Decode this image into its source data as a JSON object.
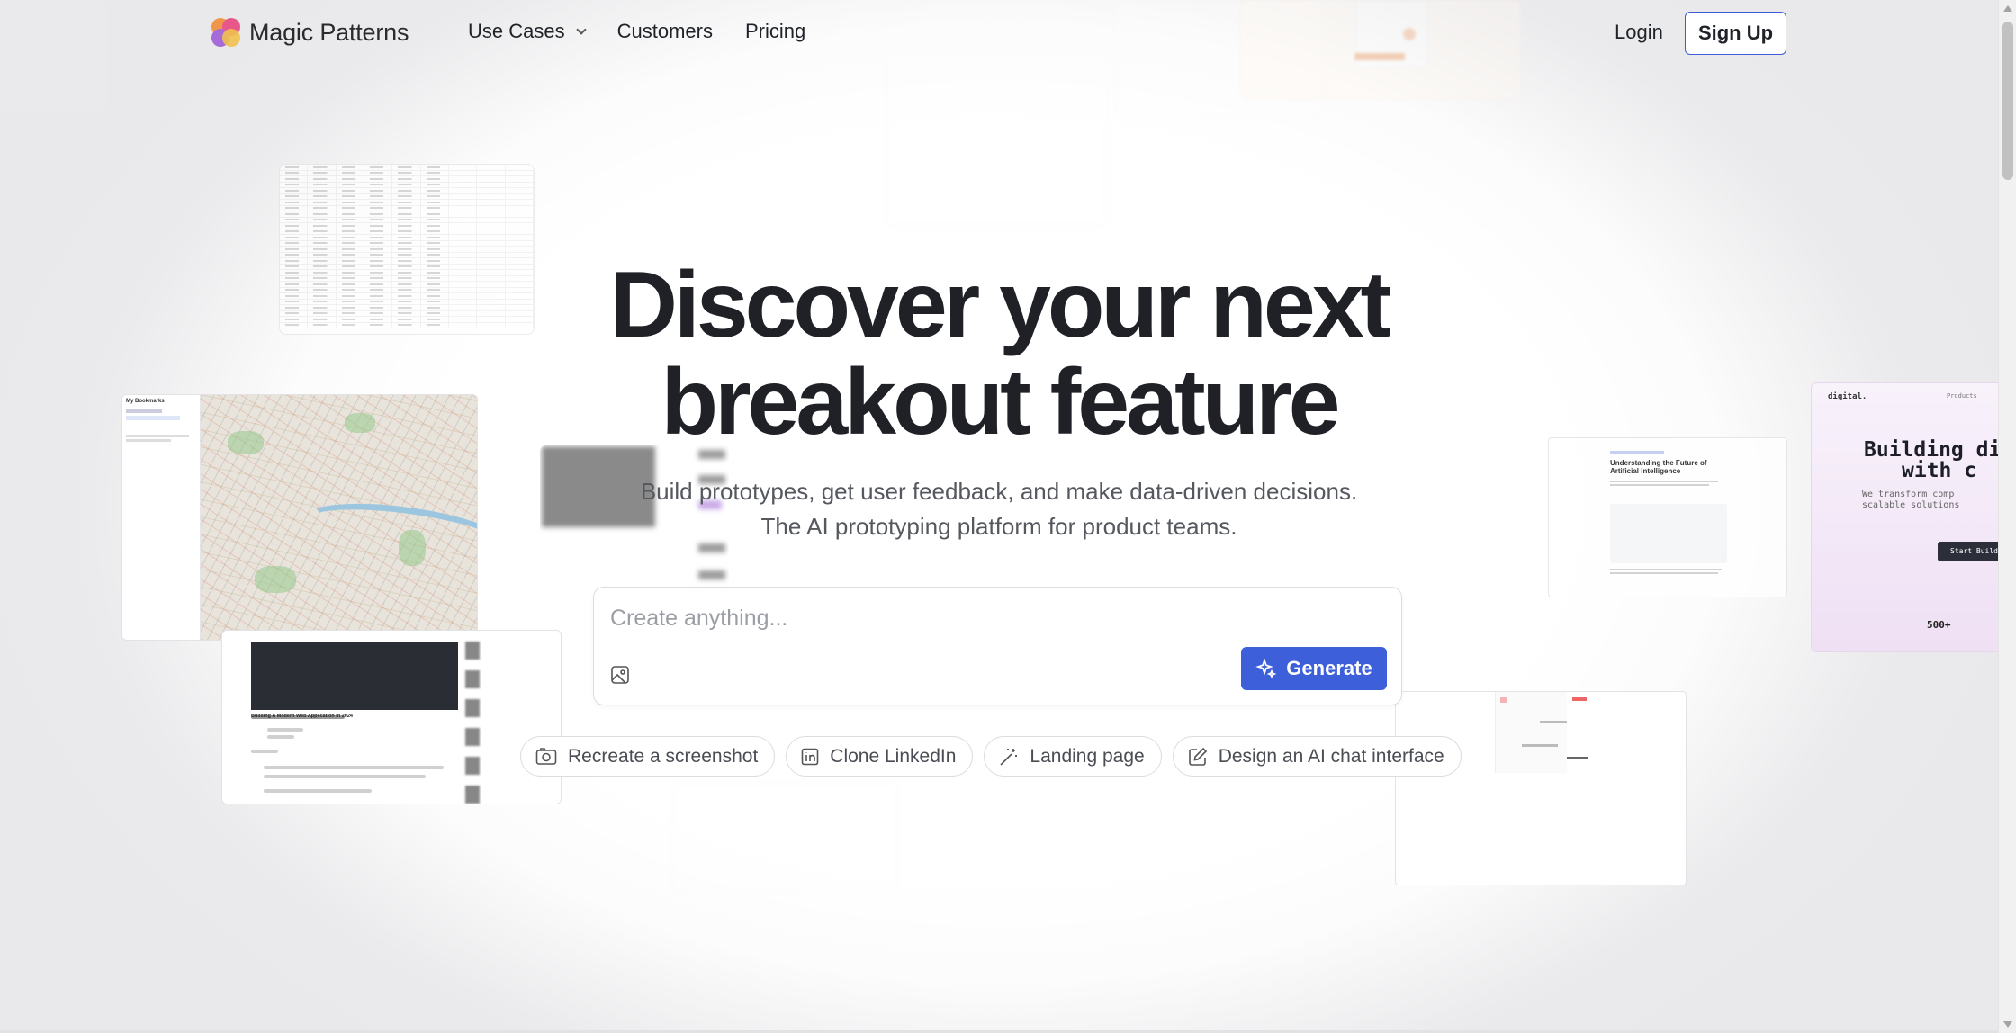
{
  "brand": {
    "name": "Magic Patterns"
  },
  "nav": {
    "links": [
      {
        "label": "Use Cases",
        "has_dropdown": true
      },
      {
        "label": "Customers"
      },
      {
        "label": "Pricing"
      }
    ],
    "login_label": "Login",
    "signup_label": "Sign Up"
  },
  "hero": {
    "headline_line1": "Discover your next",
    "headline_line2": "breakout feature",
    "subline_line1": "Build prototypes, get user feedback, and make data-driven decisions.",
    "subline_line2": "The AI prototyping platform for product teams."
  },
  "prompt": {
    "placeholder": "Create anything...",
    "generate_label": "Generate"
  },
  "suggestions": [
    {
      "label": "Recreate a screenshot",
      "icon": "camera-icon"
    },
    {
      "label": "Clone LinkedIn",
      "icon": "linkedin-icon"
    },
    {
      "label": "Landing page",
      "icon": "magic-wand-icon"
    },
    {
      "label": "Design an AI chat interface",
      "icon": "edit-icon"
    }
  ],
  "previews": {
    "map_panel_title": "My Bookmarks",
    "article_title": "Understanding the Future of Artificial Intelligence",
    "digital_brand": "digital.",
    "digital_nav": "Products",
    "digital_headline_1": "Building di",
    "digital_headline_2": "with c",
    "digital_sub_1": "We transform comp",
    "digital_sub_2": "scalable solutions",
    "digital_cta": "Start Buildi",
    "digital_stat": "500+",
    "video_title": "Building A Modern Web Application in 2024"
  },
  "colors": {
    "accent": "#3d5fd9",
    "text": "#1f2126",
    "muted": "#55585e"
  }
}
